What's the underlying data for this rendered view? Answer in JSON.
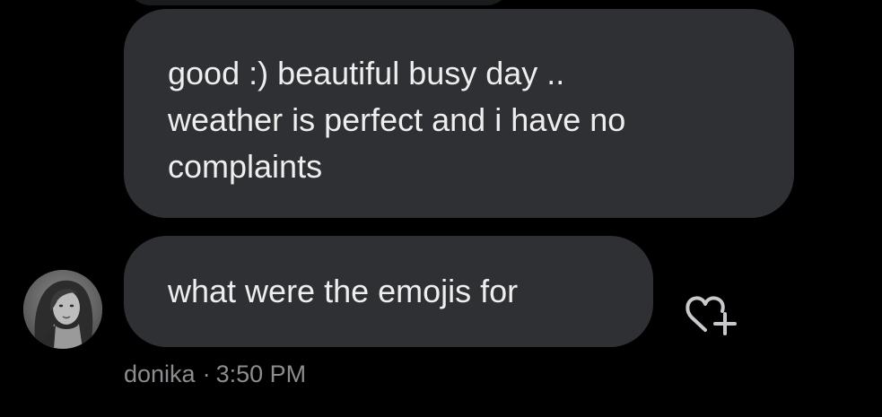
{
  "thread": {
    "messages": [
      {
        "lines": [
          "good :) beautiful busy day ..",
          "weather is perfect and i have no",
          "complaints"
        ]
      },
      {
        "lines": [
          "what were the emojis for"
        ]
      }
    ],
    "sender": {
      "name": "donika",
      "separator": "·",
      "time": "3:50 PM",
      "avatar_icon": "profile-photo-avatar"
    },
    "reaction_icon": "heart-plus-icon"
  },
  "colors": {
    "background": "#000000",
    "bubble": "#2f3033",
    "bubble_text": "#eeeeee",
    "meta_text": "#8b8d91",
    "icon": "#c8c9cc"
  }
}
